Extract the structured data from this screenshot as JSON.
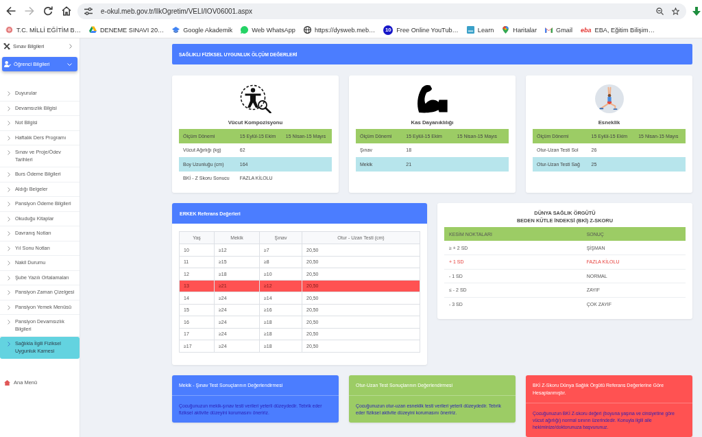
{
  "browser": {
    "nav": [
      {
        "kind": "back",
        "disabled": false
      },
      {
        "kind": "forward",
        "disabled": true
      },
      {
        "kind": "reload",
        "disabled": false
      },
      {
        "kind": "home",
        "disabled": false
      }
    ],
    "url": "e-okul.meb.gov.tr/IlkOgretim/VELI/IOV06001.aspx",
    "bookmarks": [
      {
        "label": "T.C. MİLLİ EĞİTİM B…",
        "kind": "emblem"
      },
      {
        "label": "DENEME SINAVI 20…",
        "kind": "drive"
      },
      {
        "label": "Google Akademik",
        "kind": "cap"
      },
      {
        "label": "Web WhatsApp",
        "kind": "chat"
      },
      {
        "label": "https://dysweb.meb…",
        "kind": "globe"
      },
      {
        "label": "Free Online YouTub…",
        "kind": "number",
        "badge": "10"
      },
      {
        "label": "Learn",
        "kind": "tile"
      },
      {
        "label": "Haritalar",
        "kind": "pin"
      },
      {
        "label": "Gmail",
        "kind": "mail"
      },
      {
        "label": "EBA, Eğitim Bilişim…",
        "kind": "wordmark",
        "badge": "eba"
      }
    ]
  },
  "sidebar": {
    "sections": [
      {
        "label": "Sınav Bilgileri",
        "kind": "tools",
        "expanded": false,
        "selected": false
      },
      {
        "label": "Öğrenci Bilgileri",
        "kind": "user",
        "expanded": true,
        "selected": true
      }
    ],
    "items": [
      {
        "label": "Duyurular",
        "selected": false
      },
      {
        "label": "Devamsızlık Bilgisi",
        "selected": false
      },
      {
        "label": "Not Bilgisi",
        "selected": false
      },
      {
        "label": "Haftalık Ders Programı",
        "selected": false
      },
      {
        "label": "Sınav ve Proje/Ödev Tarihleri",
        "selected": false
      },
      {
        "label": "Burs Ödeme Bilgileri",
        "selected": false
      },
      {
        "label": "Aldığı Belgeler",
        "selected": false
      },
      {
        "label": "Pansiyon Ödeme Bilgileri",
        "selected": false
      },
      {
        "label": "Okuduğu Kitaplar",
        "selected": false
      },
      {
        "label": "Davranış Notları",
        "selected": false
      },
      {
        "label": "Yıl Sonu Notları",
        "selected": false
      },
      {
        "label": "Nakil Durumu",
        "selected": false
      },
      {
        "label": "Şube Yazılı Ortalamaları",
        "selected": false
      },
      {
        "label": "Pansiyon Zaman Çizelgesi",
        "selected": false
      },
      {
        "label": "Pansiyon Yemek Menüsü",
        "selected": false
      },
      {
        "label": "Pansiyon Devamsızlık Bilgileri",
        "selected": false
      },
      {
        "label": "Sağlıkla İlgili Fiziksel Uygunluk Karnesi",
        "selected": true
      }
    ],
    "footer": {
      "label": "Ana Menü"
    }
  },
  "header": {
    "title": "SAĞLIKLI FİZİKSEL UYGUNLUK ÖLÇÜM DEĞERLERİ"
  },
  "measure_cards": [
    {
      "kind": "body",
      "title": "Vücut Kompozisyonu",
      "columns": [
        "Ölçüm Dönemi",
        "15 Eylül-15 Ekim",
        "15 Nisan-15 Mayıs"
      ],
      "rows": [
        {
          "label": "Vücut Ağırlığı (kg)",
          "values": [
            "62"
          ]
        },
        {
          "label": "Boy Uzunluğu (cm)",
          "values": [
            "164"
          ]
        },
        {
          "label": "BKİ - Z Skoru Sonucu",
          "values": [
            "FAZLA KİLOLU"
          ]
        }
      ]
    },
    {
      "kind": "muscle",
      "title": "Kas Dayanıklılığı",
      "columns": [
        "Ölçüm Dönemi",
        "15 Eylül-15 Ekim",
        "15 Nisan-15 Mayıs"
      ],
      "rows": [
        {
          "label": "Şınav",
          "values": [
            "18"
          ]
        },
        {
          "label": "Mekik",
          "values": [
            "21"
          ]
        }
      ]
    },
    {
      "kind": "stretch",
      "title": "Esneklik",
      "columns": [
        "Ölçüm Dönemi",
        "15 Eylül-15 Ekim",
        "15 Nisan-15 Mayıs"
      ],
      "rows": [
        {
          "label": "Otur-Uzan Testi Sol",
          "values": [
            "26"
          ]
        },
        {
          "label": "Otur-Uzan Testi Sağ",
          "values": [
            "25"
          ]
        }
      ]
    }
  ],
  "reference_table": {
    "title": "ERKEK Referans Değerleri",
    "columns": [
      "Yaş",
      "Mekik",
      "Şınav",
      "Otur - Uzan Testi (cm)"
    ],
    "rows": [
      {
        "cells": [
          "10",
          "≥12",
          "≥7",
          "20,50"
        ],
        "selected": false
      },
      {
        "cells": [
          "11",
          "≥15",
          "≥8",
          "20,50"
        ],
        "selected": false
      },
      {
        "cells": [
          "12",
          "≥18",
          "≥10",
          "20,50"
        ],
        "selected": false
      },
      {
        "cells": [
          "13",
          "≥21",
          "≥12",
          "20,50"
        ],
        "selected": true
      },
      {
        "cells": [
          "14",
          "≥24",
          "≥14",
          "20,50"
        ],
        "selected": false
      },
      {
        "cells": [
          "15",
          "≥24",
          "≥16",
          "20,50"
        ],
        "selected": false
      },
      {
        "cells": [
          "16",
          "≥24",
          "≥18",
          "20,50"
        ],
        "selected": false
      },
      {
        "cells": [
          "17",
          "≥24",
          "≥18",
          "20,50"
        ],
        "selected": false
      },
      {
        "cells": [
          "≥17",
          "≥24",
          "≥18",
          "20,50"
        ],
        "selected": false
      }
    ]
  },
  "bmi_table": {
    "title_lines": [
      "DÜNYA SAĞLIK ÖRGÜTÜ",
      "BEDEN KÜTLE İNDEKSİ (BKİ) Z-SKORU"
    ],
    "columns": [
      "KESİM NOKTALARI",
      "SONUÇ"
    ],
    "rows": [
      {
        "cutoff": "≥ + 2 SD",
        "result": "ŞİŞMAN",
        "selected": false
      },
      {
        "cutoff": "+ 1 SD",
        "result": "FAZLA KİLOLU",
        "selected": true
      },
      {
        "cutoff": "- 1 SD",
        "result": "NORMAL",
        "selected": false
      },
      {
        "cutoff": "≤ - 2 SD",
        "result": "ZAYIF",
        "selected": false
      },
      {
        "cutoff": "- 3 SD",
        "result": "ÇOK ZAYIF",
        "selected": false
      }
    ]
  },
  "evaluation_cards": [
    {
      "title": "Mekik - Şınav Test Sonuçlarının Değerlendirmesi",
      "text": "Çocuğunuzun mekik-şınav testi verileri yeterli düzeydedir. Tebrik eder fiziksel aktivite düzeyini korumasını öneririz.",
      "color": "#4b7dff"
    },
    {
      "title": "Otur-Uzan Test Sonuçlarının Değerlendirmesi",
      "text": "Çocuğunuzun otur-uzan esneklik testi verileri yeterli düzeydedir. Tebrik eder fiziksel aktivite düzeyini korumasını öneririz.",
      "color": "#9ccc65"
    },
    {
      "title": "BKİ Z-Skoru Dünya Sağlık Örgütü Referans Değerlerine Göre Hesaplanmıştır.",
      "text": "Çocuğunuzun BKİ Z-skoru değeri (boyuna yaşına ve cinsiyetine göre vücut ağırlığı) normal sınırın üzerindedir. Konuyla ilgili aile hekiminize/doktorunuza başvurunuz.",
      "color": "#ff5252"
    }
  ]
}
